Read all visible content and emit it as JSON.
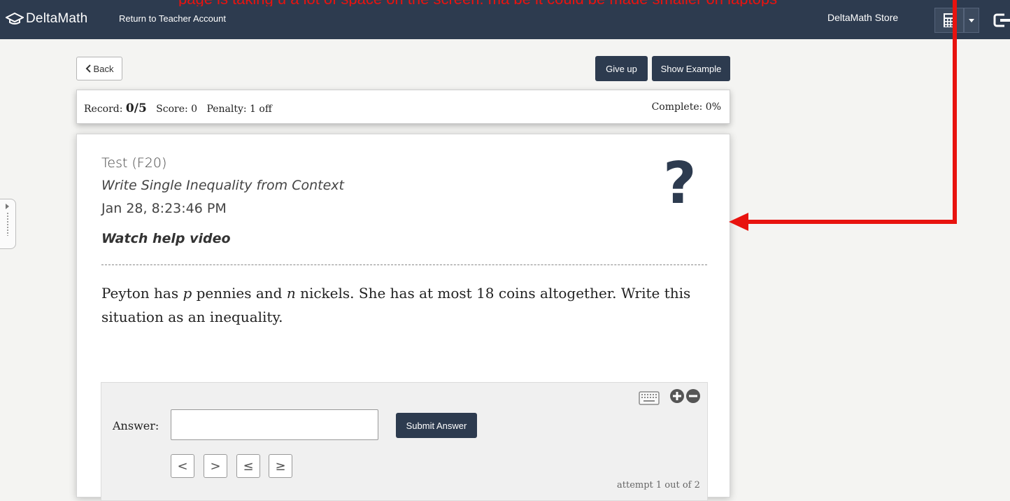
{
  "annotation": {
    "text": "page is taking u   a lot of  space on the screen. ma   be it could be  made smaller on laptops",
    "color": "#e8130f"
  },
  "nav": {
    "brand": "DeltaMath",
    "return_link": "Return to Teacher Account",
    "store_link": "DeltaMath Store"
  },
  "toolbar": {
    "back_label": "Back",
    "giveup_label": "Give up",
    "example_label": "Show Example"
  },
  "record": {
    "record_label": "Record:",
    "record_value": "0/5",
    "score": "Score: 0",
    "penalty": "Penalty: 1 off",
    "complete": "Complete: 0%"
  },
  "problem": {
    "test_name": "Test (F20)",
    "skill": "Write Single Inequality from Context",
    "timestamp": "Jan 28, 8:23:46 PM",
    "help_video": "Watch help video",
    "text_part1": "Peyton has ",
    "var_p": "p",
    "text_part2": " pennies and ",
    "var_n": "n",
    "text_part3": " nickels. She has at most 18 coins altogether. Write this situation as an inequality."
  },
  "answer": {
    "label": "Answer:",
    "value": "",
    "submit_label": "Submit Answer",
    "symbols": [
      "<",
      ">",
      "≤",
      "≥"
    ],
    "attempt": "attempt 1 out of 2"
  },
  "colors": {
    "nav_bg": "#2d3b4f",
    "accent": "#2d3b4f",
    "annotation_red": "#e8130f"
  }
}
